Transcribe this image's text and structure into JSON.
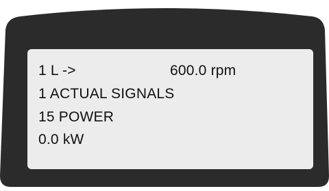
{
  "display": {
    "line1_left": "1 L ->",
    "line1_right": "600.0 rpm",
    "line2": "1 ACTUAL SIGNALS",
    "line3": "15 POWER",
    "line4": "0.0 kW"
  },
  "colors": {
    "bezel": "#2b2b2b",
    "screen": "#ececec",
    "text": "#111111",
    "background": "#ffffff"
  }
}
